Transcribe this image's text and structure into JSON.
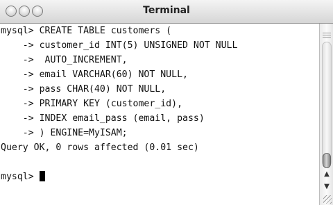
{
  "window": {
    "title": "Terminal"
  },
  "icons": {
    "close": "close-icon",
    "minimize": "minimize-icon",
    "zoom": "zoom-icon",
    "scroll_up": "scroll-up-arrow-icon",
    "scroll_down": "scroll-down-arrow-icon",
    "resize": "resize-grip-icon"
  },
  "terminal": {
    "lines": [
      "mysql> CREATE TABLE customers (",
      "    -> customer_id INT(5) UNSIGNED NOT NULL",
      "    ->  AUTO_INCREMENT,",
      "    -> email VARCHAR(60) NOT NULL,",
      "    -> pass CHAR(40) NOT NULL,",
      "    -> PRIMARY KEY (customer_id),",
      "    -> INDEX email_pass (email, pass)",
      "    -> ) ENGINE=MyISAM;",
      "Query OK, 0 rows affected (0.01 sec)",
      "",
      "mysql> "
    ]
  }
}
